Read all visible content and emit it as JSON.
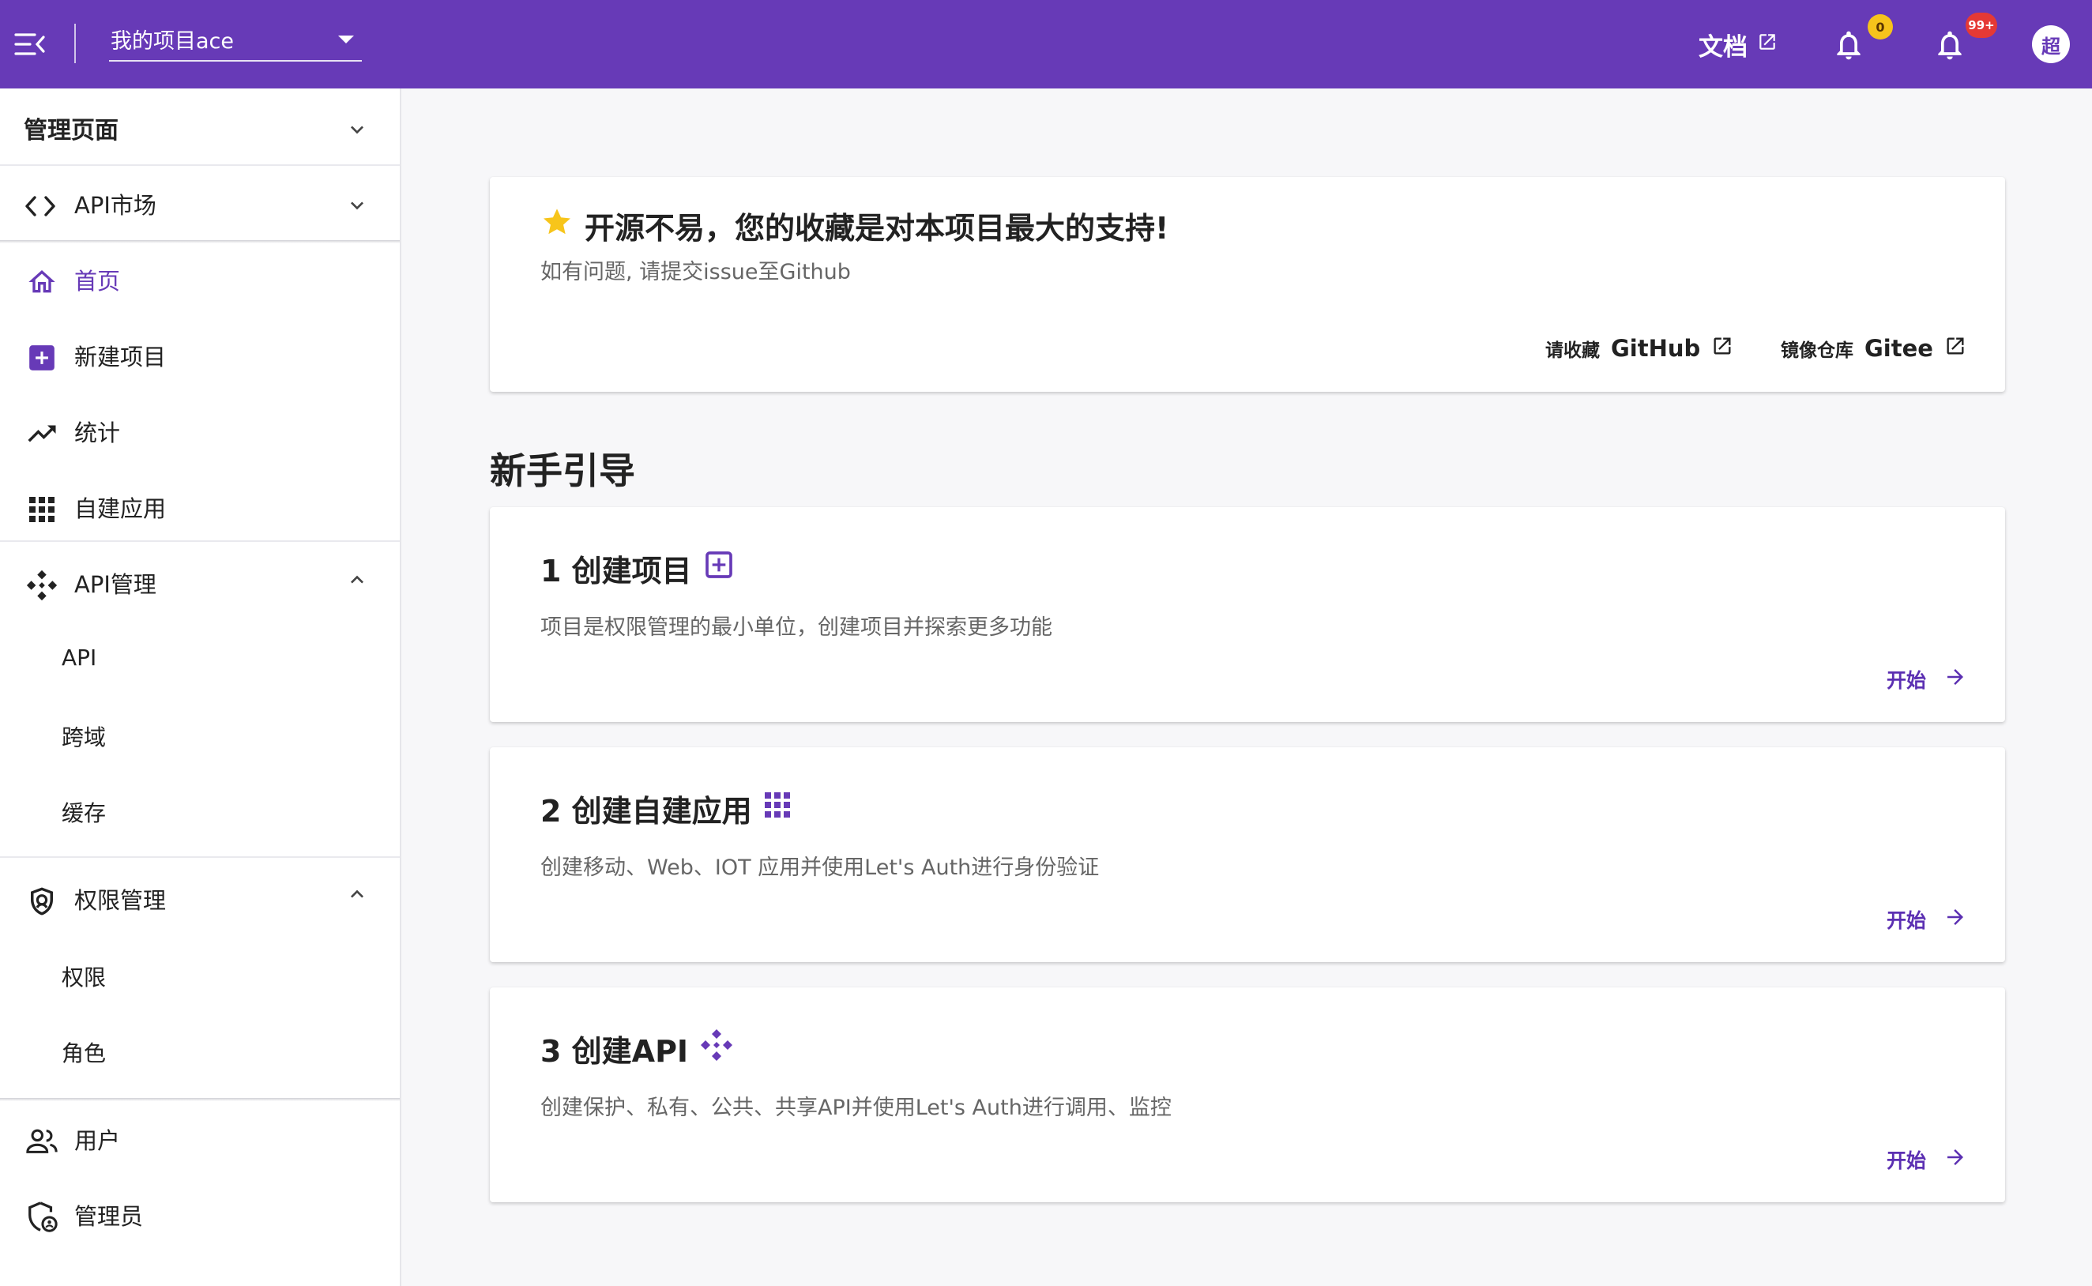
{
  "header": {
    "project_select_label": "我的项目ace",
    "docs_label": "文档",
    "notification_count": "0",
    "message_count": "99+",
    "avatar_text": "超",
    "brand_color": "#673ab7"
  },
  "sidebar": {
    "admin_page": "管理页面",
    "api_market": "API市场",
    "items": [
      {
        "label": "首页",
        "icon": "home-icon",
        "active": true
      },
      {
        "label": "新建项目",
        "icon": "add-box-icon"
      },
      {
        "label": "统计",
        "icon": "trending-up-icon"
      },
      {
        "label": "自建应用",
        "icon": "apps-grid-icon"
      }
    ],
    "api_management": {
      "label": "API管理",
      "icon": "api-diamond-icon",
      "children": [
        "API",
        "跨域",
        "缓存"
      ]
    },
    "permission_management": {
      "label": "权限管理",
      "icon": "shield-icon",
      "children": [
        "权限",
        "角色"
      ]
    },
    "users": "用户",
    "admins": "管理员"
  },
  "support_card": {
    "title": "开源不易，您的收藏是对本项目最大的支持!",
    "subtitle": "如有问题, 请提交issue至Github",
    "github_prefix": "请收藏",
    "github_name": "GitHub",
    "gitee_prefix": "镜像仓库",
    "gitee_name": "Gitee"
  },
  "guide": {
    "title": "新手引导",
    "start_label": "开始",
    "steps": [
      {
        "title": "1 创建项目",
        "description": "项目是权限管理的最小单位，创建项目并探索更多功能",
        "icon": "add-box-icon"
      },
      {
        "title": "2 创建自建应用",
        "description": "创建移动、Web、IOT 应用并使用Let's Auth进行身份验证",
        "icon": "apps-grid-icon"
      },
      {
        "title": "3 创建API",
        "description": "创建保护、私有、公共、共享API并使用Let's Auth进行调用、监控",
        "icon": "api-diamond-icon"
      }
    ]
  }
}
